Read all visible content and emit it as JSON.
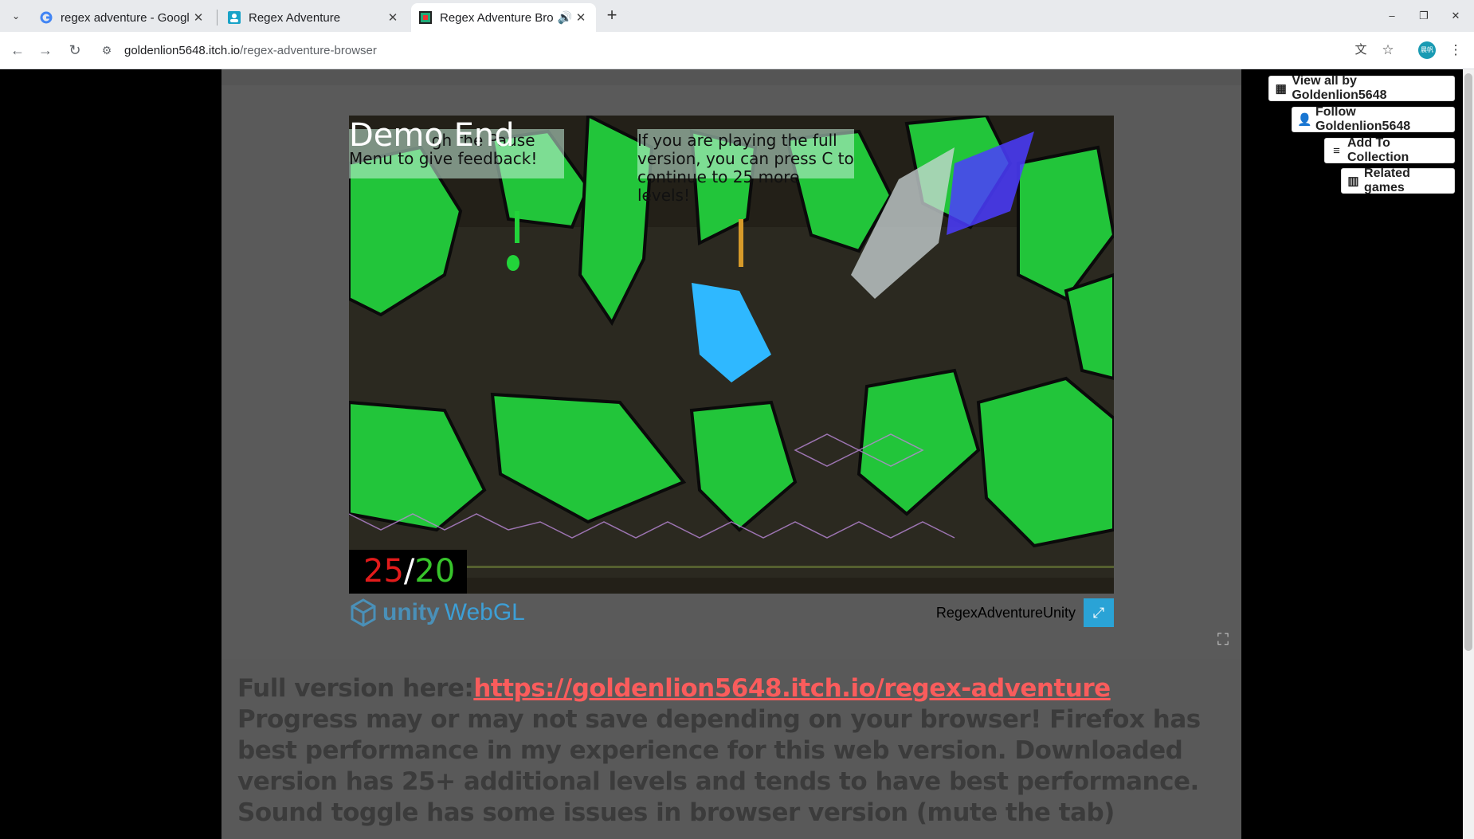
{
  "browser": {
    "tabs": [
      {
        "title": "regex adventure - Googl",
        "active": false,
        "favicon": "google-icon"
      },
      {
        "title": "Regex Adventure",
        "active": false,
        "favicon": "itch-profile-icon"
      },
      {
        "title": "Regex Adventure Bro",
        "active": true,
        "favicon": "game-icon",
        "audio": true
      }
    ],
    "url_host": "goldenlion5648.itch.io",
    "url_path": "/regex-adventure-browser",
    "profile_label": "晨帆"
  },
  "sidebar": {
    "view_all": "View all by Goldenlion5648",
    "follow": "Follow Goldenlion5648",
    "add_collection": "Add To Collection",
    "related": "Related games"
  },
  "game": {
    "demo_end": "Demo End",
    "hud_left": "gh the Pause Menu to give feedback!",
    "hud_right": "If you are playing the full version, you can press C to continue to 25 more levels!",
    "counter_current": "25",
    "counter_sep": "/",
    "counter_total": "20",
    "unity_label": "unity",
    "webgl_label": "WebGL",
    "name": "RegexAdventureUnity"
  },
  "description": {
    "prefix": "Full version here:",
    "link": "https://goldenlion5648.itch.io/regex-adventure",
    "body": " Progress may or may not save depending on your browser! Firefox has best performance in my experience for this web version. Downloaded version has 25+ additional levels and tends to have best performance. Sound toggle has some issues in browser version (mute the tab)"
  }
}
